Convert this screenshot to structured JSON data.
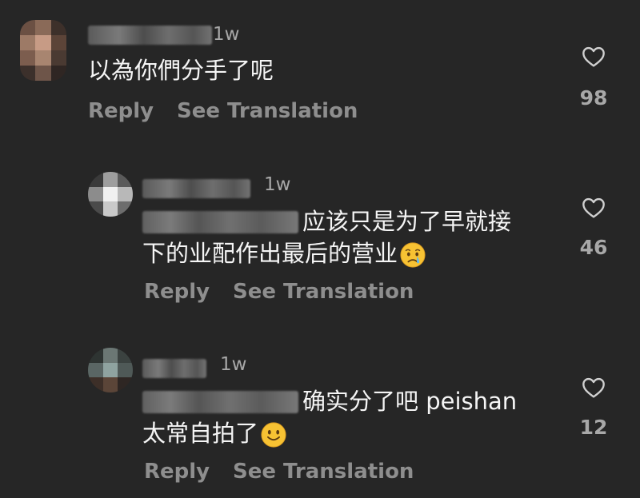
{
  "comments": [
    {
      "time": "1w",
      "text": "以為你們分手了呢",
      "reply_label": "Reply",
      "translate_label": "See Translation",
      "likes": "98"
    },
    {
      "time": "1w",
      "line1": "应该只是为了早就接",
      "line2": "下的业配作出最后的营业",
      "emoji": "crying-face",
      "reply_label": "Reply",
      "translate_label": "See Translation",
      "likes": "46"
    },
    {
      "time": "1w",
      "line1": "确实分了吧 peishan",
      "line2": "太常自拍了",
      "emoji": "smiling-face",
      "reply_label": "Reply",
      "translate_label": "See Translation",
      "likes": "12"
    }
  ],
  "colors": {
    "background": "#262626",
    "text": "#f5f5f5",
    "muted": "#8e8e8e"
  }
}
